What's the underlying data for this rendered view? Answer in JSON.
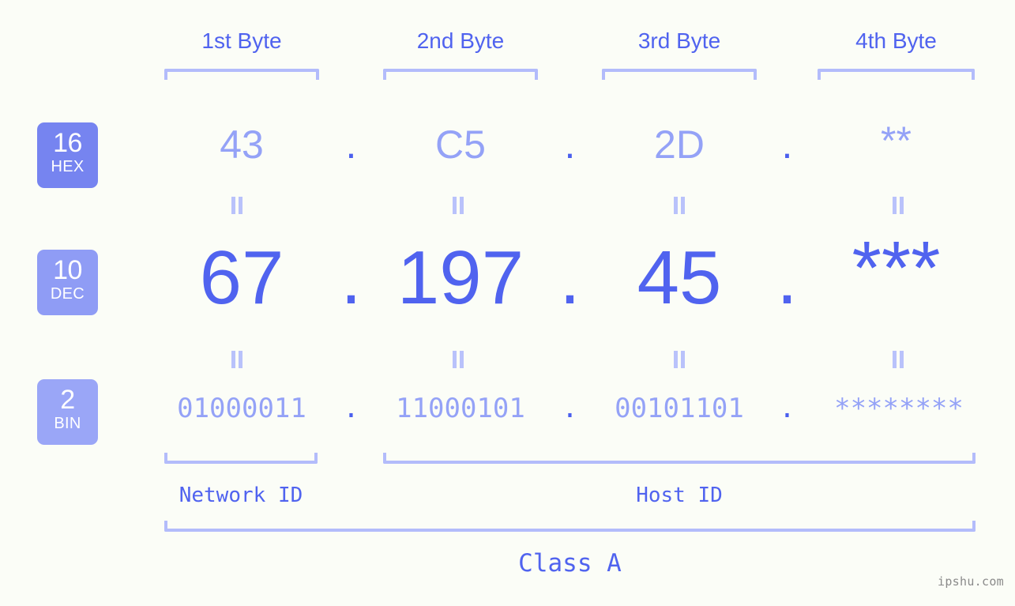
{
  "theme": {
    "background": "#fbfdf7",
    "accent_strong": "#5063ef",
    "accent_light": "#94a2f7",
    "bracket": "#b3bcfb",
    "badge_hex": "#7684f0",
    "badge_dec": "#8f9cf5",
    "badge_bin": "#9aa6f7",
    "watermark": "#8a8a8a"
  },
  "header": {
    "byte_labels": [
      "1st Byte",
      "2nd Byte",
      "3rd Byte",
      "4th Byte"
    ]
  },
  "bases": [
    {
      "number": "16",
      "name": "HEX"
    },
    {
      "number": "10",
      "name": "DEC"
    },
    {
      "number": "2",
      "name": "BIN"
    }
  ],
  "rows": {
    "hex": {
      "values": [
        "43",
        "C5",
        "2D",
        "**"
      ],
      "separator": "."
    },
    "dec": {
      "values": [
        "67",
        "197",
        "45",
        "***"
      ],
      "separator": "."
    },
    "bin": {
      "values": [
        "01000011",
        "11000101",
        "00101101",
        "********"
      ],
      "separator": "."
    }
  },
  "equality_marker": "||",
  "footer": {
    "network_id_label": "Network ID",
    "host_id_label": "Host ID",
    "class_label": "Class A"
  },
  "watermark": "ipshu.com"
}
